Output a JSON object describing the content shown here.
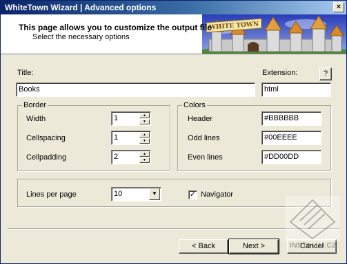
{
  "window": {
    "title": "WhiteTown Wizard | Advanced options",
    "close_glyph": "×"
  },
  "header": {
    "title": "This page allows you to customize the output file",
    "subtitle": "Select the necessary options",
    "banner_text": "WHITE TOWN"
  },
  "form": {
    "title_label": "Title:",
    "title_value": "Books",
    "extension_label": "Extension:",
    "extension_value": "html",
    "help_label": "?"
  },
  "border": {
    "legend": "Border",
    "width_label": "Width",
    "width_value": "1",
    "cellspacing_label": "Cellspacing",
    "cellspacing_value": "1",
    "cellpadding_label": "Cellpadding",
    "cellpadding_value": "2"
  },
  "colors": {
    "legend": "Colors",
    "header_label": "Header",
    "header_value": "#BBBBBB",
    "odd_label": "Odd lines",
    "odd_value": "#00EEEE",
    "even_label": "Even lines",
    "even_value": "#DD00DD"
  },
  "paging": {
    "lines_label": "Lines per page",
    "lines_value": "10",
    "navigator_label": "Navigator",
    "navigator_checked": true
  },
  "buttons": {
    "back_label": "< Back",
    "next_label": "Next >",
    "cancel_label": "Cancel"
  },
  "watermark": {
    "text": "INSTALUJ.CZ"
  },
  "icons": [
    "close-icon",
    "spin-up-icon",
    "spin-down-icon",
    "dropdown-arrow-icon",
    "checkmark-icon",
    "castle-logo",
    "watermark-logo"
  ]
}
